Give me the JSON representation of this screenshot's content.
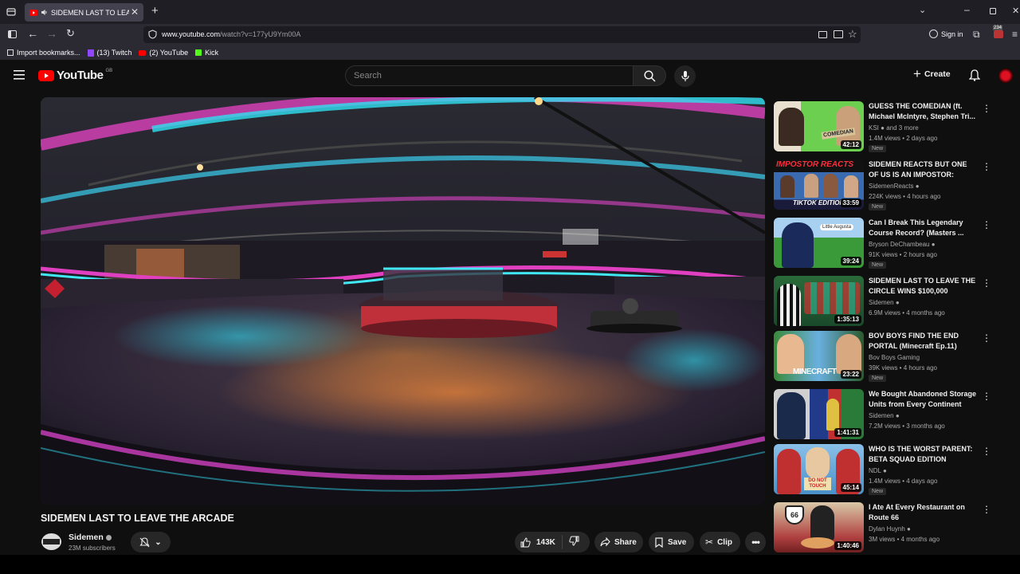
{
  "browser": {
    "tab_title": "SIDEMEN LAST TO LEAVE THE ARCADE",
    "url_host": "www.youtube.com",
    "url_path": "/watch?v=177yU9Ym00A",
    "sign_in": "Sign in",
    "badge": "234",
    "bookmarks": [
      "Import bookmarks...",
      "(13) Twitch",
      "(2) YouTube",
      "Kick"
    ]
  },
  "yt": {
    "logo": "YouTube",
    "region": "GB",
    "search_placeholder": "Search",
    "create": "Create"
  },
  "video": {
    "title": "SIDEMEN LAST TO LEAVE THE ARCADE",
    "channel": "Sidemen",
    "subscribers": "23M subscribers",
    "likes": "143K",
    "share": "Share",
    "save": "Save",
    "clip": "Clip"
  },
  "recommendations": [
    {
      "title": "GUESS THE COMEDIAN (ft. Michael McIntyre, Stephen Tri...",
      "channel": "KSI",
      "extra": "and 3 more",
      "meta": "1.4M views • 2 days ago",
      "duration": "42:12",
      "badge": "New"
    },
    {
      "title": "SIDEMEN REACTS BUT ONE OF US IS AN IMPOSTOR: TIKTOK ...",
      "channel": "SidemenReacts",
      "extra": "",
      "meta": "224K views • 4 hours ago",
      "duration": "33:59",
      "badge": "New"
    },
    {
      "title": "Can I Break This Legendary Course Record? (Masters ...",
      "channel": "Bryson DeChambeau",
      "extra": "",
      "meta": "91K views • 2 hours ago",
      "duration": "39:24",
      "badge": "New"
    },
    {
      "title": "SIDEMEN LAST TO LEAVE THE CIRCLE WINS $100,000",
      "channel": "Sidemen",
      "extra": "",
      "meta": "6.9M views • 4 months ago",
      "duration": "1:35:13",
      "badge": ""
    },
    {
      "title": "BOV BOYS FIND THE END PORTAL (Minecraft Ep.11)",
      "channel": "Bov Boys Gaming",
      "extra": "",
      "meta": "39K views • 4 hours ago",
      "duration": "23:22",
      "badge": "New"
    },
    {
      "title": "We Bought Abandoned Storage Units from Every Continent an...",
      "channel": "Sidemen",
      "extra": "",
      "meta": "7.2M views • 3 months ago",
      "duration": "1:41:31",
      "badge": ""
    },
    {
      "title": "WHO IS THE WORST PARENT: BETA SQUAD EDITION",
      "channel": "NDL",
      "extra": "",
      "meta": "1.4M views • 4 days ago",
      "duration": "45:14",
      "badge": "New"
    },
    {
      "title": "I Ate At Every Restaurant on Route 66",
      "channel": "Dylan Huynh",
      "extra": "",
      "meta": "3M views • 4 months ago",
      "duration": "1:40:46",
      "badge": ""
    }
  ],
  "thumb_text": {
    "t0": "COMEDIAN",
    "t1a": "IMPOSTOR REACTS",
    "t1b": "TIKTOK EDITION",
    "t2": "Little Augusta",
    "t4": "MINECRAFT",
    "t6": "DO NOT TOUCH",
    "t7": "66"
  },
  "colors": {
    "accent": "#ff0000",
    "bg": "#0f0f0f",
    "pill": "#272727"
  }
}
